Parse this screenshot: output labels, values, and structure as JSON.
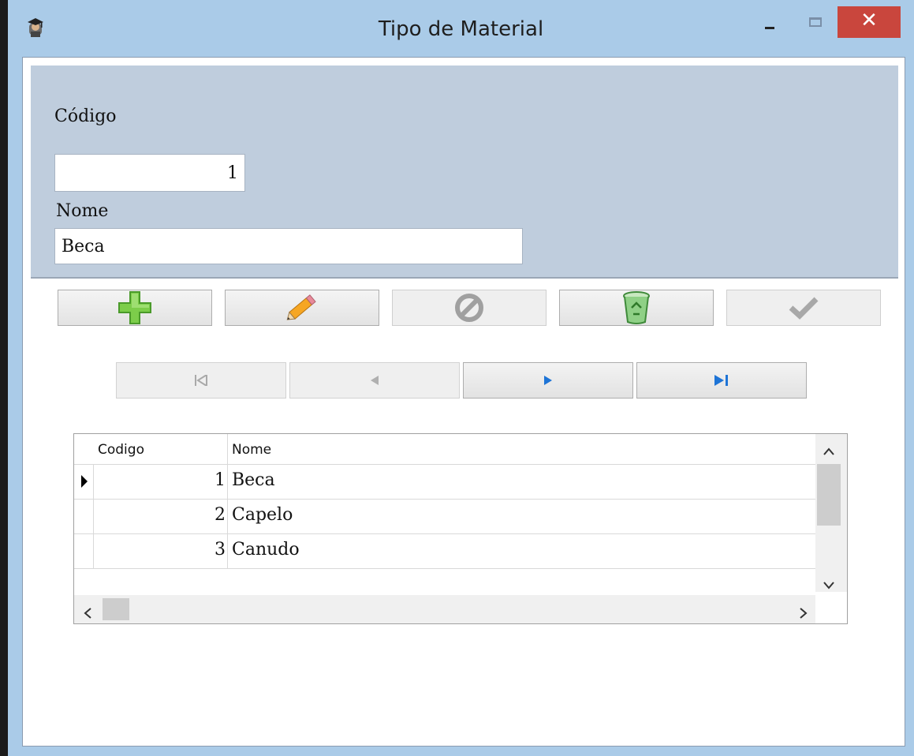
{
  "window": {
    "title": "Tipo de Material",
    "close_symbol": "✕"
  },
  "form": {
    "codigo_label": "Código",
    "codigo_value": "1",
    "nome_label": "Nome",
    "nome_value": "Beca"
  },
  "toolbar": {
    "buttons": [
      {
        "icon": "plus-icon",
        "enabled": true
      },
      {
        "icon": "pencil-icon",
        "enabled": true
      },
      {
        "icon": "cancel-icon",
        "enabled": false
      },
      {
        "icon": "recycle-bin-icon",
        "enabled": true
      },
      {
        "icon": "checkmark-icon",
        "enabled": false
      }
    ]
  },
  "navigator": {
    "buttons": [
      {
        "icon": "first-record-icon",
        "enabled": false
      },
      {
        "icon": "prior-record-icon",
        "enabled": false
      },
      {
        "icon": "next-record-icon",
        "enabled": true
      },
      {
        "icon": "last-record-icon",
        "enabled": true
      }
    ]
  },
  "grid": {
    "columns": [
      "Codigo",
      "Nome"
    ],
    "rows": [
      {
        "codigo": "1",
        "nome": "Beca",
        "current": true
      },
      {
        "codigo": "2",
        "nome": "Capelo",
        "current": false
      },
      {
        "codigo": "3",
        "nome": "Canudo",
        "current": false
      }
    ]
  },
  "colors": {
    "titlebar": "#aacbe8",
    "close_button": "#c9463d",
    "form_panel": "#bfcddd",
    "accent_blue": "#1e74d6"
  }
}
